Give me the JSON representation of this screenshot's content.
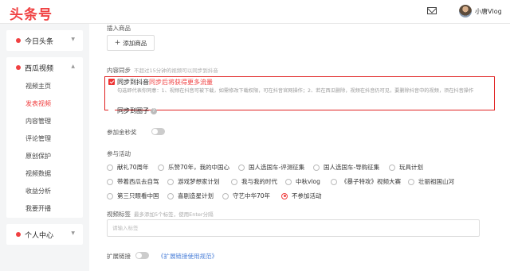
{
  "header": {
    "logo": "头条号",
    "username": "小唐Vlog",
    "icons": [
      "mail-icon",
      "avatar"
    ]
  },
  "sidebar": {
    "sections": [
      {
        "label": "今日头条",
        "color": "#f04142"
      },
      {
        "label": "西瓜视频",
        "color": "#f04142"
      },
      {
        "label": "个人中心",
        "color": "#f04142"
      }
    ],
    "items": [
      "视频主页",
      "发表视频",
      "内容管理",
      "评论管理",
      "原创保护",
      "视频数据",
      "收益分析",
      "我要开播"
    ],
    "active_item": "发表视频"
  },
  "form": {
    "insert_product_label": "插入商品",
    "add_product_button": "添加商品",
    "sync_label": "内容同步",
    "sync_hint": "不超过15分钟的视频可以同步到抖音",
    "sync_douyin_label": "同步到抖音",
    "sync_douyin_promo": "同步后将获得更多流量",
    "sync_desc": "勾选即代表你同意：1、视频在抖音可被下载，如需修改下载权限，可在抖音官网操作；2、若在西瓜删除，视频在抖音仍可见，要删除抖音中的视频，须在抖音操作",
    "sync_circle_label": "同步到圈子",
    "million_label": "参加金秒奖",
    "activity_label": "参与活动",
    "activities": [
      "献礼70周年",
      "乐赞70年，我的中国心",
      "国人选国车-评测征集",
      "国人选国车-导购征集",
      "玩具计划",
      "带着西瓜去自驾",
      "游戏梦想家计划",
      "我与我的时代",
      "中秋vlog",
      "《暴子特攻》视频大赛",
      "壮丽祖国山河",
      "第三只眼看中国",
      "喜剧造星计划",
      "守艺中华70年",
      "不参加活动"
    ],
    "selected_activity": "不参加活动",
    "tags_label": "视频标签",
    "tags_hint": "最多添加5个标签，使用Enter分隔",
    "tags_placeholder": "请输入标签",
    "ext_link_label": "扩展链接",
    "ext_link_rules": "《扩展链接使用规范》"
  },
  "colors": {
    "accent": "#f04142",
    "highlight_border": "#e02020",
    "link": "#4a7fd8"
  }
}
